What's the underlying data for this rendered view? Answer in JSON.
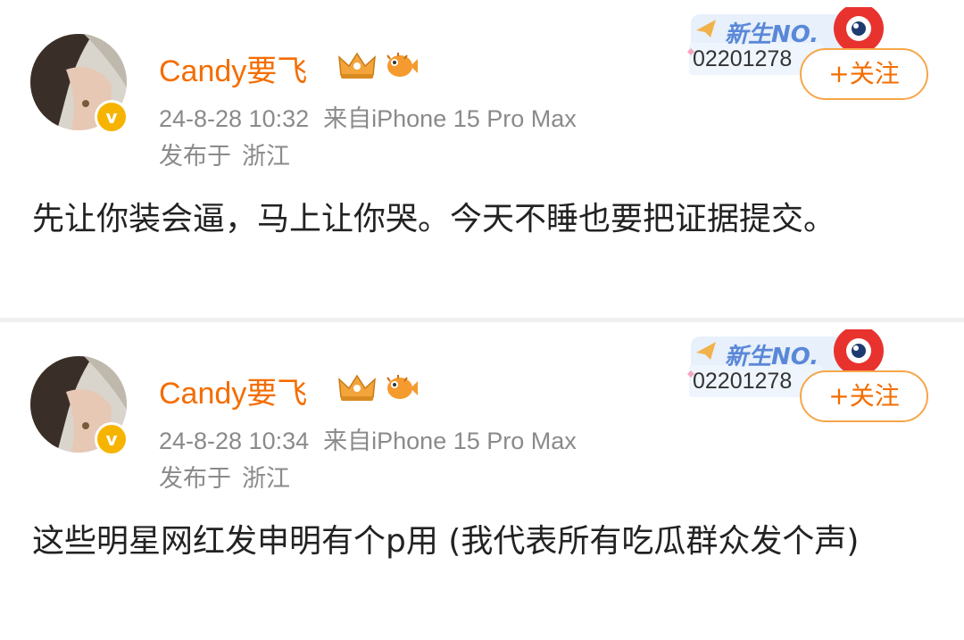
{
  "posts": [
    {
      "username": "Candy要飞",
      "timestamp": "24-8-28 10:32",
      "source": "来自iPhone 15 Pro Max",
      "location_prefix": "发布于",
      "location": "浙江",
      "content": "先让你装会逼，马上让你哭。今天不睡也要把证据提交。",
      "badge_label": "新生NO.",
      "badge_number": "02201278",
      "follow_label": "+关注"
    },
    {
      "username": "Candy要飞",
      "timestamp": "24-8-28 10:34",
      "source": "来自iPhone 15 Pro Max",
      "location_prefix": "发布于",
      "location": "浙江",
      "content": "这些明星网红发申明有个p用 (我代表所有吃瓜群众发个声)",
      "badge_label": "新生NO.",
      "badge_number": "02201278",
      "follow_label": "+关注"
    }
  ],
  "colors": {
    "username": "#f46d00",
    "meta": "#8a8a8a",
    "verified": "#f6b400",
    "follow_border": "#f7a64a"
  },
  "icons": [
    "verified-badge-icon",
    "crown-icon",
    "pufferfish-icon",
    "weibo-logo-icon",
    "paper-plane-icon"
  ]
}
